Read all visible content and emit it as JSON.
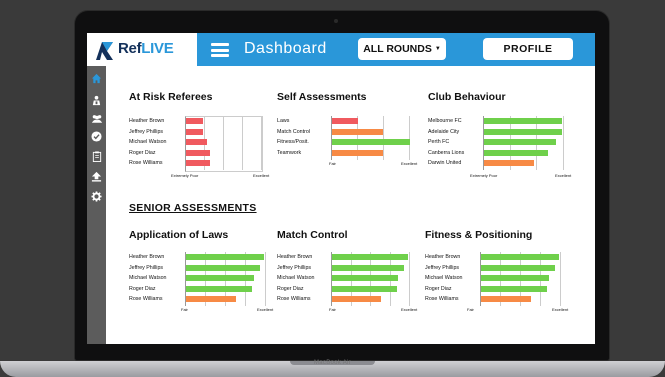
{
  "device": {
    "model_label": "MacBook Air"
  },
  "header": {
    "logo_ref": "Ref",
    "logo_live": "LIVE",
    "title": "Dashboard",
    "rounds_label": "ALL ROUNDS",
    "profile_label": "PROFILE"
  },
  "sidebar": {
    "items": [
      {
        "icon": "home-icon",
        "active": true
      },
      {
        "icon": "referee-icon"
      },
      {
        "icon": "users-icon"
      },
      {
        "icon": "check-circle-icon"
      },
      {
        "icon": "clipboard-icon"
      },
      {
        "icon": "upload-icon"
      },
      {
        "icon": "gear-icon"
      }
    ]
  },
  "colors": {
    "accent": "#2a97d9",
    "red": "#f05a5f",
    "orange": "#f78a45",
    "green": "#6fd04b",
    "sidebar": "#5c5c5c"
  },
  "panels": {
    "at_risk": {
      "title": "At Risk Referees",
      "axis_min": "Extremely Poor",
      "axis_max": "Excellent",
      "rows": [
        {
          "label": "Heather Brown",
          "value": 0.22,
          "color": "red"
        },
        {
          "label": "Jeffrey Phillips",
          "value": 0.22,
          "color": "red"
        },
        {
          "label": "Michael Watson",
          "value": 0.27,
          "color": "red"
        },
        {
          "label": "Roger Diaz",
          "value": 0.32,
          "color": "red"
        },
        {
          "label": "Rose Williams",
          "value": 0.32,
          "color": "red"
        }
      ]
    },
    "self_assessments": {
      "title": "Self Assessments",
      "axis_min": "Fair",
      "axis_max": "Excellent",
      "rows": [
        {
          "label": "Laws",
          "value": 0.33,
          "color": "red"
        },
        {
          "label": "Match Control",
          "value": 0.66,
          "color": "orange"
        },
        {
          "label": "Fitness/Posit.",
          "value": 1.0,
          "color": "green"
        },
        {
          "label": "Teamwork",
          "value": 0.66,
          "color": "orange"
        }
      ]
    },
    "club_behaviour": {
      "title": "Club Behaviour",
      "axis_min": "Extremely Poor",
      "axis_max": "Excellent",
      "rows": [
        {
          "label": "Melbourne FC",
          "value": 0.97,
          "color": "green"
        },
        {
          "label": "Adelaide City",
          "value": 0.97,
          "color": "green"
        },
        {
          "label": "Perth FC",
          "value": 0.9,
          "color": "green"
        },
        {
          "label": "Canberra Lions",
          "value": 0.8,
          "color": "green"
        },
        {
          "label": "Darwin United",
          "value": 0.62,
          "color": "orange"
        }
      ]
    },
    "section_heading": "SENIOR ASSESSMENTS",
    "laws": {
      "title": "Application of Laws",
      "axis_min": "Fair",
      "axis_max": "Excellent",
      "rows": [
        {
          "label": "Heather Brown",
          "value": 0.98,
          "color": "green"
        },
        {
          "label": "Jeffrey Phillips",
          "value": 0.92,
          "color": "green"
        },
        {
          "label": "Michael Watson",
          "value": 0.85,
          "color": "green"
        },
        {
          "label": "Roger Diaz",
          "value": 0.83,
          "color": "green"
        },
        {
          "label": "Rose Williams",
          "value": 0.63,
          "color": "orange"
        }
      ]
    },
    "match_control": {
      "title": "Match Control",
      "axis_min": "Fair",
      "axis_max": "Excellent",
      "rows": [
        {
          "label": "Heather Brown",
          "value": 0.98,
          "color": "green"
        },
        {
          "label": "Jeffrey Phillips",
          "value": 0.92,
          "color": "green"
        },
        {
          "label": "Michael Watson",
          "value": 0.85,
          "color": "green"
        },
        {
          "label": "Roger Diaz",
          "value": 0.83,
          "color": "green"
        },
        {
          "label": "Rose Williams",
          "value": 0.63,
          "color": "orange"
        }
      ]
    },
    "fitness": {
      "title": "Fitness & Positioning",
      "axis_min": "Fair",
      "axis_max": "Excellent",
      "rows": [
        {
          "label": "Heather Brown",
          "value": 0.98,
          "color": "green"
        },
        {
          "label": "Jeffrey Phillips",
          "value": 0.92,
          "color": "green"
        },
        {
          "label": "Michael Watson",
          "value": 0.85,
          "color": "green"
        },
        {
          "label": "Roger Diaz",
          "value": 0.83,
          "color": "green"
        },
        {
          "label": "Rose Williams",
          "value": 0.63,
          "color": "orange"
        }
      ]
    }
  }
}
